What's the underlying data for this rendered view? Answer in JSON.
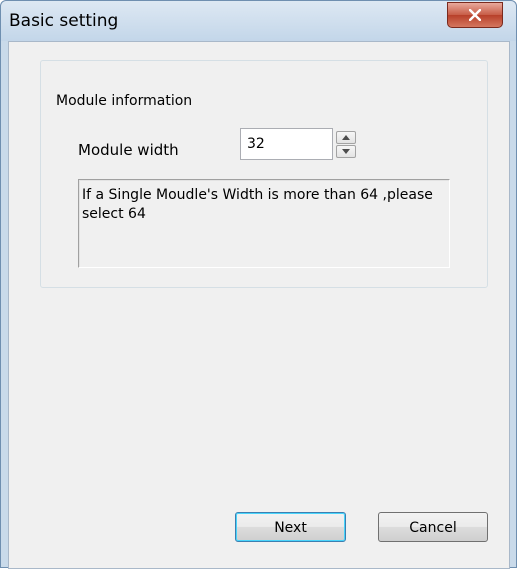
{
  "window": {
    "title": "Basic setting",
    "close_icon": "close-x-icon"
  },
  "group": {
    "label": "Module information"
  },
  "module_width": {
    "label": "Module width",
    "value": "32",
    "spin_up_icon": "triangle-up-icon",
    "spin_down_icon": "triangle-down-icon"
  },
  "info": {
    "text": "If a Single Moudle's Width is more than 64 ,please select 64"
  },
  "buttons": {
    "next_label": "Next",
    "cancel_label": "Cancel"
  },
  "colors": {
    "close_button": "#c75c46",
    "dialog_background": "#f0f0f0",
    "title_bar": "#c9daea",
    "default_button_border": "#3c7fb1"
  }
}
